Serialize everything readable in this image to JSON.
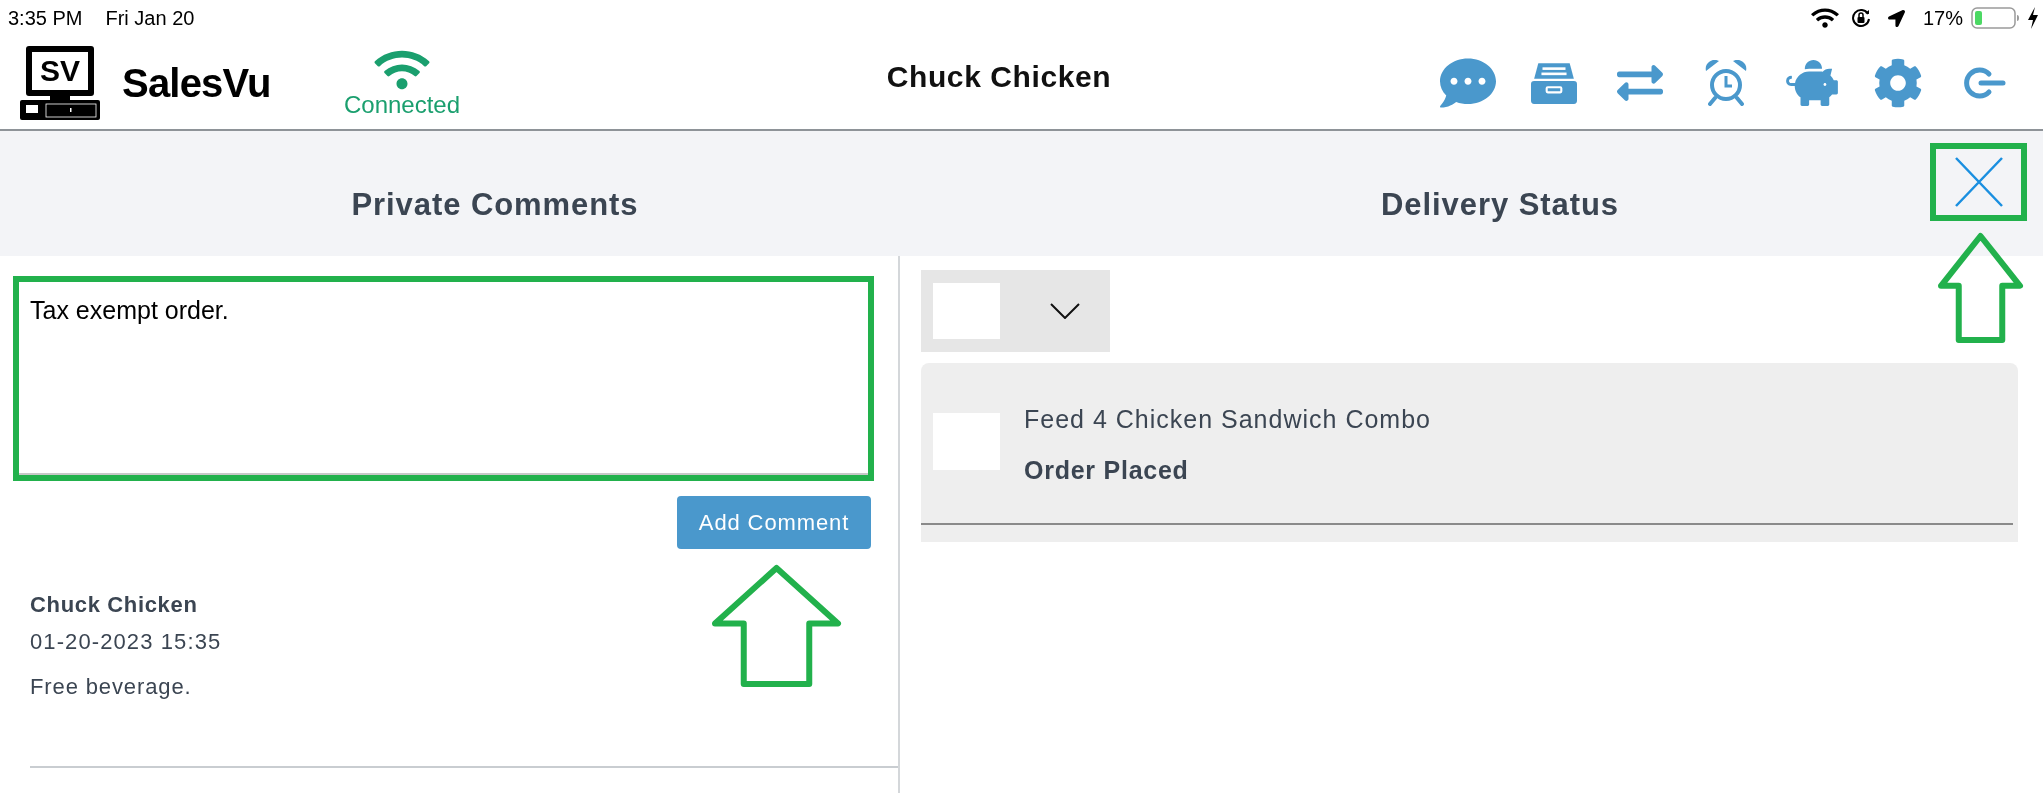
{
  "status_bar": {
    "time": "3:35 PM",
    "date": "Fri Jan 20",
    "battery_percent": "17%"
  },
  "header": {
    "logo_text": "SV",
    "brand": "SalesVu",
    "connection": "Connected",
    "title": "Chuck Chicken"
  },
  "sections": [
    {
      "title": "Private Comments"
    },
    {
      "title": "Delivery Status"
    }
  ],
  "comments": {
    "value": "Tax exempt order.",
    "button": "Add Comment",
    "entries": [
      {
        "author": "Chuck Chicken",
        "timestamp": "01-20-2023 15:35",
        "text": "Free beverage."
      }
    ]
  },
  "delivery": {
    "orders": [
      {
        "name": "Feed 4 Chicken Sandwich Combo",
        "status": "Order Placed"
      }
    ]
  }
}
